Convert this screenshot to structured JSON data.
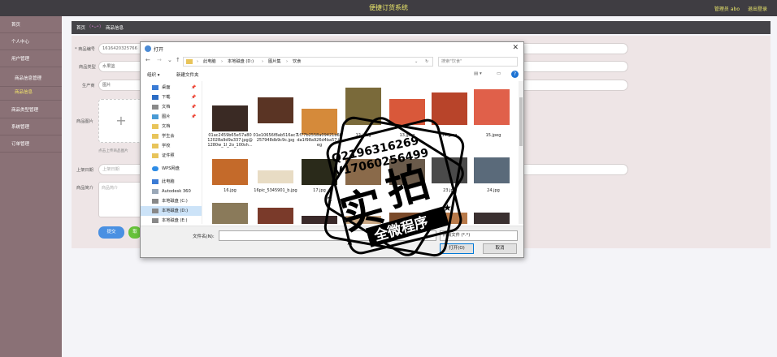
{
  "header": {
    "title": "便捷订货系统",
    "admin_label": "管理员 abo",
    "logout_label": "退出登录"
  },
  "sidebar": {
    "items": [
      {
        "label": "首页"
      },
      {
        "label": "个人中心"
      },
      {
        "label": "用户管理"
      },
      {
        "label": "商品信息管理"
      },
      {
        "label": "商品信息"
      },
      {
        "label": "商品类型管理"
      },
      {
        "label": "系统管理"
      },
      {
        "label": "订单管理"
      }
    ]
  },
  "breadcrumb": {
    "home": "首页",
    "sep": "(•ᴗ•)",
    "current": "商品信息"
  },
  "form": {
    "code_label": "* 商品编号",
    "code_value": "1616420325766",
    "type_label": "商品类型",
    "type_value": "水果篮",
    "maker_label": "生产商",
    "maker_value": "图片",
    "image_label": "商品图片",
    "upload_plus": "+",
    "upload_hint": "点击上传商品图片",
    "date_label": "上架日期",
    "date_placeholder": "上架日期",
    "intro_label": "商品简介",
    "intro_placeholder": "商品简介",
    "submit_label": "提交",
    "cancel_label": "取"
  },
  "dialog": {
    "title": "打开",
    "close": "✕",
    "nav_back": "←",
    "nav_forward": "→",
    "nav_dropdown": "⌄",
    "nav_up": "↑",
    "path": [
      "此电脑",
      "本地磁盘 (D:)",
      "图片集",
      "饮食"
    ],
    "search_placeholder": "搜索\"饮食\"",
    "organize": "组织 ▾",
    "new_folder": "新建文件夹",
    "help": "?",
    "tree": [
      {
        "label": "桌面",
        "pinned": true
      },
      {
        "label": "下载",
        "pinned": true
      },
      {
        "label": "文档",
        "pinned": true
      },
      {
        "label": "图片",
        "pinned": true
      },
      {
        "label": "文档"
      },
      {
        "label": "学生会"
      },
      {
        "label": "学校"
      },
      {
        "label": "证件照"
      },
      {
        "label": "WPS网盘"
      },
      {
        "label": "此电脑"
      },
      {
        "label": "Autodesk 360"
      },
      {
        "label": "本地磁盘 (C:)"
      },
      {
        "label": "本地磁盘 (D:)"
      },
      {
        "label": "本地磁盘 (E:)"
      }
    ],
    "files": [
      {
        "name": "01ac2459b65e57a8012028a9d9a337.jpg@1280w_1l_2o_100sh...",
        "color": "#3a2a24"
      },
      {
        "name": "01e10656f8ab516ac7257948db9c9c.jpg",
        "color": "#5a3424"
      },
      {
        "name": "1f77b2558a09421b6bda1f98a926d4ba57.jpeg",
        "color": "#d58a3a"
      },
      {
        "name": "12.jpeg",
        "color": "#7a6a3a"
      },
      {
        "name": "13.jpeg",
        "color": "#d9583a"
      },
      {
        "name": "14.jpeg",
        "color": "#b8442a"
      },
      {
        "name": "15.jpeg",
        "color": "#e0604a"
      },
      {
        "name": "16.jpg",
        "color": "#c46a2a"
      },
      {
        "name": "16pic_5345901_b.jpg",
        "color": "#e8dcc4"
      },
      {
        "name": "17.jpg",
        "color": "#2a2a1a"
      },
      {
        "name": "",
        "color": "#8a6a4a"
      },
      {
        "name": "",
        "color": "#6a5a4a"
      },
      {
        "name": "23.jpg",
        "color": "#4a4a4a"
      },
      {
        "name": "24.jpg",
        "color": "#5a6a7a"
      },
      {
        "name": "",
        "color": "#8a7a5a"
      },
      {
        "name": "",
        "color": "#7a3a2a"
      },
      {
        "name": "",
        "color": "#3a2a2a"
      },
      {
        "name": "",
        "color": "#caa884"
      },
      {
        "name": "",
        "color": "#7a4a2a"
      },
      {
        "name": "",
        "color": "#b87a4a"
      },
      {
        "name": "",
        "color": "#3a3030"
      }
    ],
    "filename_label": "文件名(N):",
    "filetype_value": "所有文件 (*.*)",
    "open_button": "打开(O)",
    "cancel_button": "取消"
  },
  "watermark": {
    "line1": "Q2196316269",
    "line2": "V17060256499",
    "big1": "实",
    "big2": "拍",
    "banner": "全微程序"
  },
  "colors": {
    "topbar": "#3f3d42",
    "sidebar": "#8a7176",
    "accent": "#4a90e2",
    "submit": "#4a90e2",
    "cancel": "#67c23a"
  }
}
